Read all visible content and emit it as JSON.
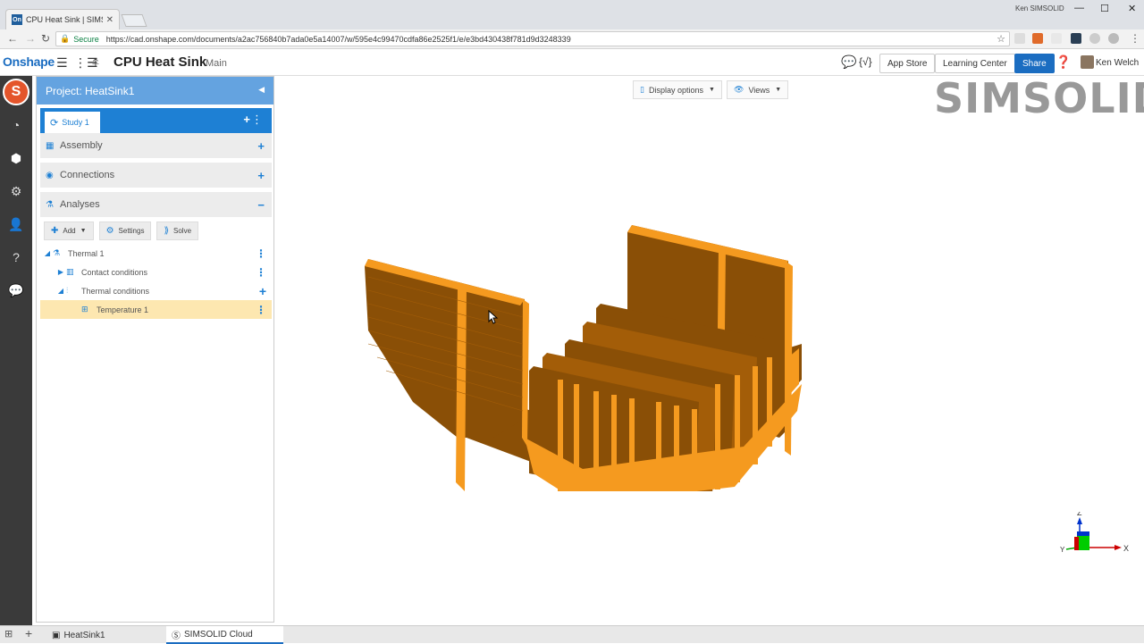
{
  "browser": {
    "tab_title": "CPU Heat Sink | SIMSOLID",
    "tab_favicon": "On",
    "window_user": "Ken SIMSOLID",
    "secure_label": "Secure",
    "url": "https://cad.onshape.com/documents/a2ac756840b7ada0e5a14007/w/595e4c99470cdfa86e2525f1/e/e3bd430438f781d9d3248339"
  },
  "onshape": {
    "logo": "Onshape",
    "doc_title": "CPU Heat Sink",
    "branch": "Main",
    "app_store": "App Store",
    "learning_center": "Learning Center",
    "share": "Share",
    "user_name": "Ken Welch"
  },
  "panel": {
    "project_title": "Project: HeatSink1",
    "study_tab": "Study 1",
    "sections": {
      "assembly": "Assembly",
      "connections": "Connections",
      "analyses": "Analyses"
    },
    "actions": {
      "add": "Add",
      "settings": "Settings",
      "solve": "Solve"
    },
    "tree": {
      "thermal": "Thermal 1",
      "contact": "Contact conditions",
      "thermal_conditions": "Thermal conditions",
      "temperature": "Temperature 1"
    }
  },
  "viewport": {
    "display_options": "Display options",
    "views": "Views",
    "watermark": "SIMSOLID",
    "axes": {
      "z": "Z",
      "x": "X",
      "y": "Y"
    }
  },
  "bottom": {
    "tab1": "HeatSink1",
    "tab2": "SIMSOLID Cloud"
  },
  "colors": {
    "onshape_blue": "#1b6dc1",
    "panel_header": "#64a3e0",
    "study_bar": "#1e80d4",
    "selected_row": "#fde7b0",
    "model_orange": "#f59a1f",
    "model_shadow": "#8a4f06"
  }
}
